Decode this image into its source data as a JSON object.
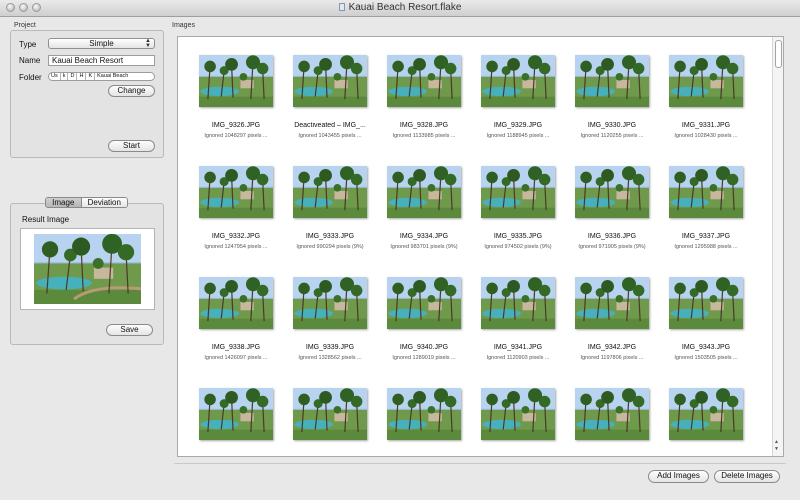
{
  "window": {
    "title": "Kauai Beach Resort.flake"
  },
  "project": {
    "group_label": "Project",
    "type_label": "Type",
    "type_value": "Simple",
    "name_label": "Name",
    "name_value": "Kauai Beach Resort",
    "folder_label": "Folder",
    "folder_path": [
      "Us",
      "k",
      "D",
      "H",
      "K",
      "Kauai Beach"
    ],
    "change_button": "Change",
    "start_button": "Start"
  },
  "result": {
    "tabs": [
      {
        "label": "Image",
        "selected": true
      },
      {
        "label": "Deviation",
        "selected": false
      }
    ],
    "result_label": "Result Image",
    "save_button": "Save"
  },
  "images": {
    "group_label": "Images",
    "items": [
      {
        "name": "IMG_9326.JPG",
        "info": "Ignored 1048297 pixels ..."
      },
      {
        "name": "Deactiveated – IMG_...",
        "info": "Ignored 1043455 pixels ..."
      },
      {
        "name": "IMG_9328.JPG",
        "info": "Ignored 1133985 pixels ..."
      },
      {
        "name": "IMG_9329.JPG",
        "info": "Ignored 1188945 pixels ..."
      },
      {
        "name": "IMG_9330.JPG",
        "info": "Ignored 1120255 pixels ..."
      },
      {
        "name": "IMG_9331.JPG",
        "info": "Ignored 1028430 pixels ..."
      },
      {
        "name": "IMG_9332.JPG",
        "info": "Ignored 1247954 pixels ..."
      },
      {
        "name": "IMG_9333.JPG",
        "info": "Ignored 990294 pixels (9%)"
      },
      {
        "name": "IMG_9334.JPG",
        "info": "Ignored 983701 pixels (9%)"
      },
      {
        "name": "IMG_9335.JPG",
        "info": "Ignored 974502 pixels (9%)"
      },
      {
        "name": "IMG_9336.JPG",
        "info": "Ignored 971905 pixels (9%)"
      },
      {
        "name": "IMG_9337.JPG",
        "info": "Ignored 1295988 pixels ..."
      },
      {
        "name": "IMG_9338.JPG",
        "info": "Ignored 1426097 pixels ..."
      },
      {
        "name": "IMG_9339.JPG",
        "info": "Ignored 1328562 pixels ..."
      },
      {
        "name": "IMG_9340.JPG",
        "info": "Ignored 1289019 pixels ..."
      },
      {
        "name": "IMG_9341.JPG",
        "info": "Ignored 1120903 pixels ..."
      },
      {
        "name": "IMG_9342.JPG",
        "info": "Ignored 1197806 pixels ..."
      },
      {
        "name": "IMG_9343.JPG",
        "info": "Ignored 1503505 pixels ..."
      },
      {
        "name": "",
        "info": ""
      },
      {
        "name": "",
        "info": ""
      },
      {
        "name": "",
        "info": ""
      },
      {
        "name": "",
        "info": ""
      },
      {
        "name": "",
        "info": ""
      },
      {
        "name": "",
        "info": ""
      }
    ]
  },
  "footer": {
    "add_button": "Add Images",
    "delete_button": "Delete Images"
  },
  "icons": {
    "photo": "resort-photo-thumbnail",
    "scroll": "vertical-scrollbar"
  }
}
